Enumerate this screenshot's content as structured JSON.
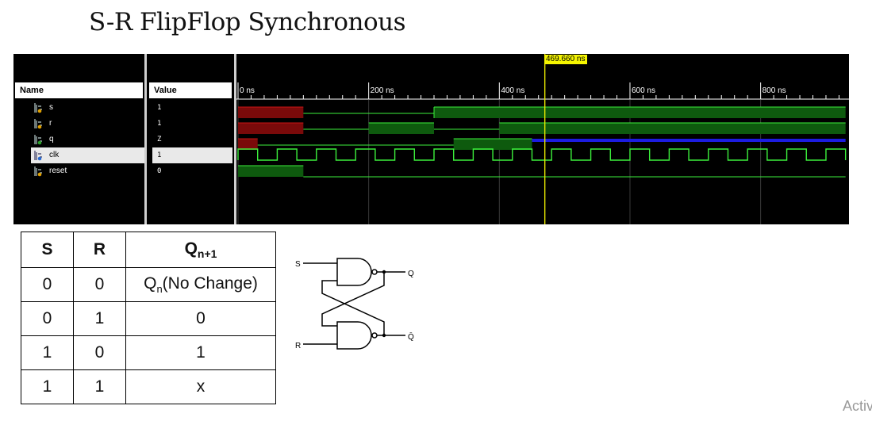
{
  "title": "S-R FlipFlop Synchronous",
  "simulator": {
    "cursor_label": "469.660 ns",
    "columns": {
      "name": "Name",
      "value": "Value"
    },
    "signals": [
      {
        "name": "s",
        "value": "1"
      },
      {
        "name": "r",
        "value": "1"
      },
      {
        "name": "q",
        "value": "Z"
      },
      {
        "name": "clk",
        "value": "1"
      },
      {
        "name": "reset",
        "value": "0"
      }
    ],
    "time_ticks": [
      "0 ns",
      "200 ns",
      "400 ns",
      "600 ns",
      "800 ns"
    ],
    "cursor_time_ns": 469.66,
    "time_span_ns": [
      0,
      930
    ],
    "colors": {
      "high": "#1a7a1a",
      "red": "#c81414",
      "clk": "#3cf03c",
      "blue": "#1c1ce0",
      "cursor": "#e8e800"
    }
  },
  "truth_table": {
    "headers": [
      "S",
      "R",
      "Qn+1"
    ],
    "header_q": "Q",
    "header_q_sub": "n+1",
    "rows": [
      {
        "s": "0",
        "r": "0",
        "q": "(No Change)",
        "q_prefix": "Q",
        "q_sub": "n"
      },
      {
        "s": "0",
        "r": "1",
        "q": "0"
      },
      {
        "s": "1",
        "r": "0",
        "q": "1"
      },
      {
        "s": "1",
        "r": "1",
        "q": "x"
      }
    ]
  },
  "circuit": {
    "labels": {
      "s": "S",
      "r": "R",
      "q": "Q",
      "qbar": "Q̄"
    }
  },
  "watermark": "Activ"
}
